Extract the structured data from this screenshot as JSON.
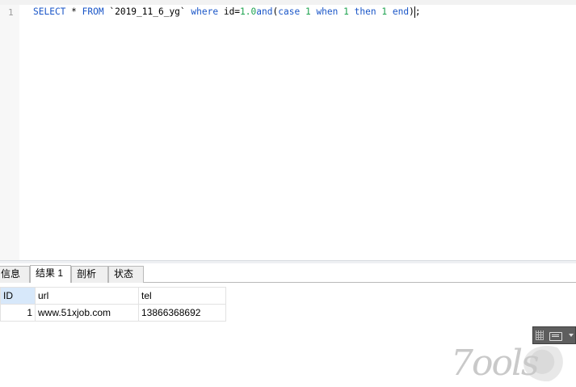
{
  "editor": {
    "line_number": "1",
    "tokens": [
      {
        "text": "SELECT",
        "cls": "kw"
      },
      {
        "text": " ",
        "cls": "plain"
      },
      {
        "text": "*",
        "cls": "plain"
      },
      {
        "text": " ",
        "cls": "plain"
      },
      {
        "text": "FROM",
        "cls": "kw"
      },
      {
        "text": " `2019_11_6_yg` ",
        "cls": "plain"
      },
      {
        "text": "where",
        "cls": "kw"
      },
      {
        "text": " id=",
        "cls": "plain"
      },
      {
        "text": "1.0",
        "cls": "num"
      },
      {
        "text": "and",
        "cls": "kw"
      },
      {
        "text": "(",
        "cls": "plain"
      },
      {
        "text": "case",
        "cls": "kw"
      },
      {
        "text": " ",
        "cls": "plain"
      },
      {
        "text": "1",
        "cls": "num"
      },
      {
        "text": " ",
        "cls": "plain"
      },
      {
        "text": "when",
        "cls": "kw"
      },
      {
        "text": " ",
        "cls": "plain"
      },
      {
        "text": "1",
        "cls": "num"
      },
      {
        "text": " ",
        "cls": "plain"
      },
      {
        "text": "then",
        "cls": "kw"
      },
      {
        "text": " ",
        "cls": "plain"
      },
      {
        "text": "1",
        "cls": "num"
      },
      {
        "text": " ",
        "cls": "plain"
      },
      {
        "text": "end",
        "cls": "kw"
      },
      {
        "text": ")",
        "cls": "plain"
      },
      {
        "text": ";",
        "cls": "plain"
      }
    ],
    "cursor_after_index": 24
  },
  "tabs": [
    {
      "label": "信息",
      "active": false
    },
    {
      "label": "结果 1",
      "active": true
    },
    {
      "label": "剖析",
      "active": false
    },
    {
      "label": "状态",
      "active": false
    }
  ],
  "grid": {
    "columns": [
      "ID",
      "url",
      "tel"
    ],
    "rows": [
      {
        "id": "1",
        "url": "www.51xjob.com",
        "tel": "13866368692"
      }
    ]
  },
  "watermark": {
    "text": "7ools"
  },
  "colors": {
    "keyword": "#1a56c8",
    "number": "#1ea34f",
    "selected_header": "#d7e8fa"
  },
  "icons": {
    "status_grip": "grip-icon",
    "status_keyboard": "keyboard-icon",
    "status_caret": "caret-down-icon"
  }
}
